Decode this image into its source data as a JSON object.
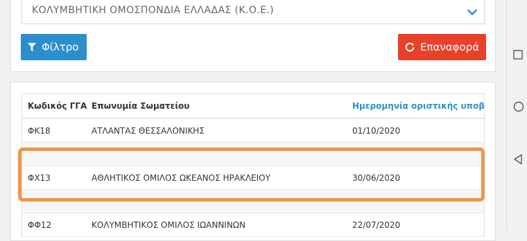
{
  "filter": {
    "federation_select_value": "ΚΟΛΥΜΒΗΤΙΚΗ ΟΜΟΣΠΟΝΔΙΑ ΕΛΛΑΔΑΣ (Κ.Ο.Ε.)",
    "filter_button_label": "Φίλτρο",
    "reset_button_label": "Επαναφορά"
  },
  "table": {
    "columns": [
      "Κωδικός ΓΓΑ",
      "Επωνυμία Σωματείου",
      "Ημερομηνία οριστικής υποβολή"
    ],
    "rows": [
      {
        "code": "ΦΚ18",
        "name": "ΑΤΛΑΝΤΑΣ ΘΕΣΣΑΛΟΝΙΚΗΣ",
        "date": "01/10/2020"
      },
      {
        "code": "",
        "name": "",
        "date": ""
      },
      {
        "code": "ΦΧ13",
        "name": "ΑΘΛΗΤΙΚΟΣ ΟΜΙΛΟΣ ΩΚΕΑΝΟΣ ΗΡΑΚΛΕΙΟΥ",
        "date": "30/06/2020"
      },
      {
        "code": "",
        "name": "",
        "date": ""
      },
      {
        "code": "ΦΦ12",
        "name": "ΚΟΛΥΜΒΗΤΙΚΟΣ ΟΜΙΛΟΣ ΙΩΑΝΝΙΝΩΝ",
        "date": "22/07/2020"
      }
    ]
  },
  "colors": {
    "filter_button": "#2b8fcd",
    "reset_button": "#e8412a",
    "highlight_outline": "#f0954a",
    "link_header": "#2893c6"
  },
  "icons": {
    "filter": "funnel-icon",
    "reset": "refresh-icon",
    "select": "chevron-down-icon",
    "nav": [
      "square-recents-icon",
      "circle-home-icon",
      "triangle-back-icon"
    ]
  }
}
